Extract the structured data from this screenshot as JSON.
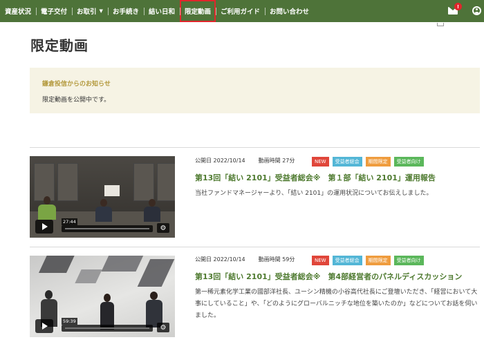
{
  "nav": {
    "items": [
      {
        "label": "資産状況"
      },
      {
        "label": "電子交付"
      },
      {
        "label": "お取引",
        "caret": "▼"
      },
      {
        "label": "お手続き"
      },
      {
        "label": "結い日和"
      },
      {
        "label": "限定動画",
        "active": true
      },
      {
        "label": "ご利用ガイド"
      },
      {
        "label": "お問い合わせ"
      }
    ],
    "mail_badge": "!",
    "icons": [
      "mail-icon",
      "user-icon"
    ]
  },
  "page": {
    "title": "限定動画"
  },
  "notice": {
    "title": "鎌倉投信からのお知らせ",
    "body": "限定動画を公開中です。"
  },
  "videos": [
    {
      "published": "公開日 2022/10/14",
      "duration_label": "動画時間 27分",
      "tags": [
        "NEW",
        "受益者総会",
        "期間限定",
        "受益者向け"
      ],
      "title": "第13回「結い 2101」受益者総会※　第１部「結い 2101」運用報告",
      "description": "当社ファンドマネージャーより、「結い 2101」の運用状況についてお伝えしました。",
      "player_time": "27:44"
    },
    {
      "published": "公開日 2022/10/14",
      "duration_label": "動画時間 59分",
      "tags": [
        "NEW",
        "受益者総会",
        "期間限定",
        "受益者向け"
      ],
      "title": "第13回「結い 2101」受益者総会※　第4部経営者のパネルディスカッション",
      "description": "第一稀元素化学工業の國部洋社長、ユーシン精機の小谷高代社長にご登壇いただき、「経営において大事にしていること」や、「どのようにグローバルニッチな地位を築いたのか」などについてお話を伺いました。",
      "player_time": "59:39"
    }
  ],
  "colors": {
    "nav_bg": "#4e7339",
    "active_outline": "#e0262b",
    "title_green": "#4e7a2f",
    "notice_bg": "#f6f3e4",
    "notice_title": "#b49a3e",
    "tag_new": "#e0463a",
    "tag_holders": "#53b6d6",
    "tag_limited": "#ef9c3e",
    "tag_forholders": "#5bb75b"
  }
}
